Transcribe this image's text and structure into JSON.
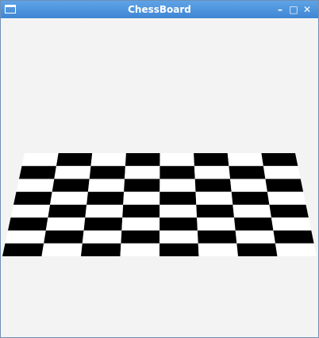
{
  "window": {
    "title": "ChessBoard",
    "buttons": {
      "minimize": "–",
      "maximize": "□",
      "close": "✕"
    }
  },
  "board": {
    "rows": 8,
    "cols": 8,
    "dark_color": "#000000",
    "light_color": "#ffffff"
  }
}
